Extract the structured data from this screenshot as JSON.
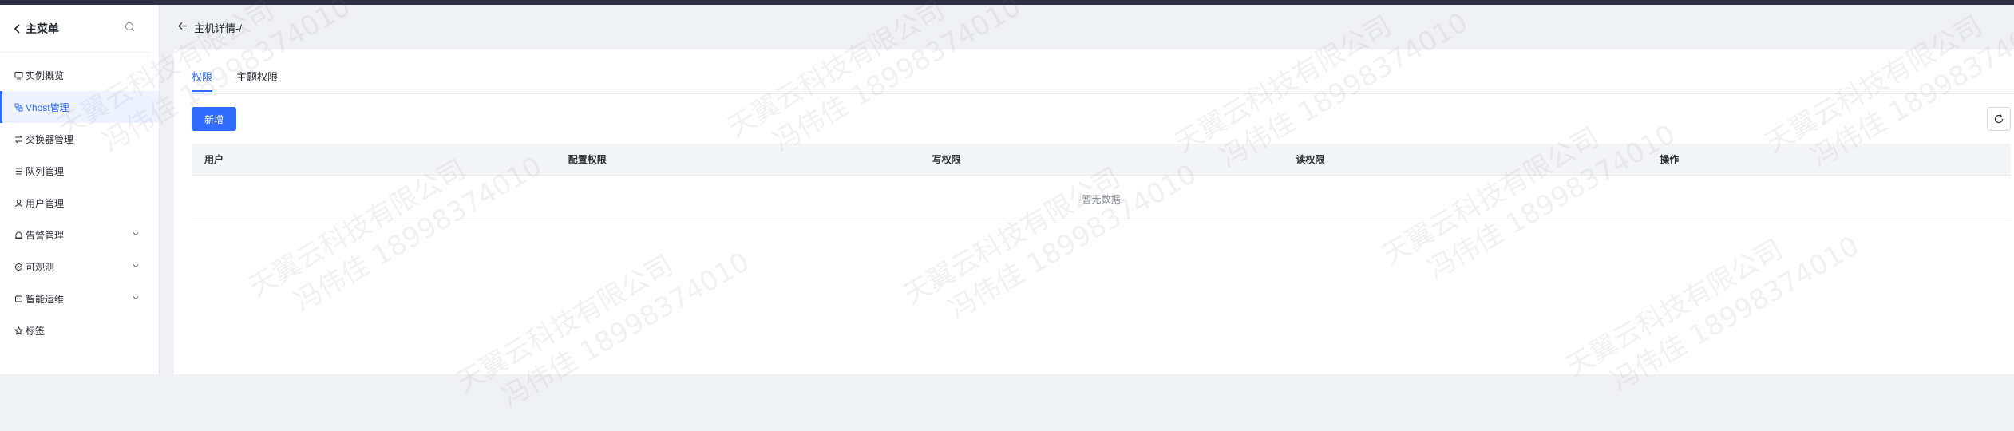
{
  "sidebar": {
    "back_label": "主菜单",
    "items": [
      {
        "label": "实例概览",
        "icon": "overview-icon"
      },
      {
        "label": "Vhost管理",
        "icon": "vhost-icon",
        "active": true
      },
      {
        "label": "交换器管理",
        "icon": "exchange-icon"
      },
      {
        "label": "队列管理",
        "icon": "queue-icon"
      },
      {
        "label": "用户管理",
        "icon": "user-icon"
      },
      {
        "label": "告警管理",
        "icon": "alarm-icon",
        "expandable": true
      },
      {
        "label": "可观测",
        "icon": "observe-icon",
        "expandable": true
      },
      {
        "label": "智能运维",
        "icon": "ops-icon",
        "expandable": true
      },
      {
        "label": "标签",
        "icon": "tag-icon"
      }
    ]
  },
  "header": {
    "title": "主机详情-/"
  },
  "tabs": [
    {
      "label": "权限",
      "active": true
    },
    {
      "label": "主题权限",
      "active": false
    }
  ],
  "toolbar": {
    "new_label": "新增"
  },
  "table": {
    "columns": [
      "用户",
      "配置权限",
      "写权限",
      "读权限",
      "操作"
    ],
    "empty_text": "暂无数据"
  },
  "watermark": {
    "line1": "天翼云科技有限公司",
    "line2": "冯伟佳 18998374010"
  },
  "colors": {
    "accent": "#2f6bff",
    "topbar": "#2c2f44",
    "page_bg": "#f0f1f4"
  }
}
